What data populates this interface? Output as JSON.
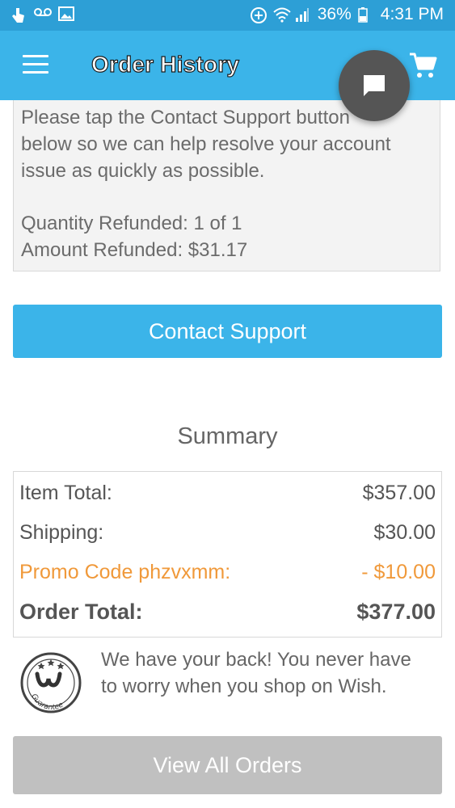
{
  "status_bar": {
    "battery": "36%",
    "time": "4:31 PM"
  },
  "app_bar": {
    "title": "Order History"
  },
  "refund_message": {
    "lines": [
      "Please tap the Contact Support button",
      "below so we can help resolve your account",
      "issue as quickly as possible."
    ],
    "quantity_refunded": "Quantity Refunded: 1 of 1",
    "amount_refunded": "Amount Refunded: $31.17"
  },
  "contact_support": {
    "label": "Contact Support"
  },
  "summary": {
    "title": "Summary",
    "rows": [
      {
        "label": "Item Total:",
        "value": "$357.00"
      },
      {
        "label": "Shipping:",
        "value": "$30.00"
      },
      {
        "label": "Promo Code phzvxmm:",
        "value": "- $10.00"
      },
      {
        "label": "Order Total:",
        "value": "$377.00"
      }
    ]
  },
  "guarantee": {
    "text": "We have your back! You never have to worry when you shop on Wish.",
    "seal_text": "Guarantee"
  },
  "view_all_orders": {
    "label": "View All Orders"
  },
  "icons": {
    "status_left": [
      "touch-icon",
      "voicemail-icon",
      "image-icon"
    ],
    "status_right": [
      "data-saver-icon",
      "wifi-icon",
      "signal-icon",
      "battery-icon"
    ],
    "menu": "hamburger-menu-icon",
    "cart": "shopping-cart-icon",
    "chat": "chat-bubble-icon"
  },
  "colors": {
    "status_bar": "#2d9fd6",
    "app_bar": "#3bb4e9",
    "primary_button": "#3bb4e9",
    "disabled_button": "#c0c0c0",
    "promo": "#f0993a",
    "chat_fab": "#555555"
  }
}
